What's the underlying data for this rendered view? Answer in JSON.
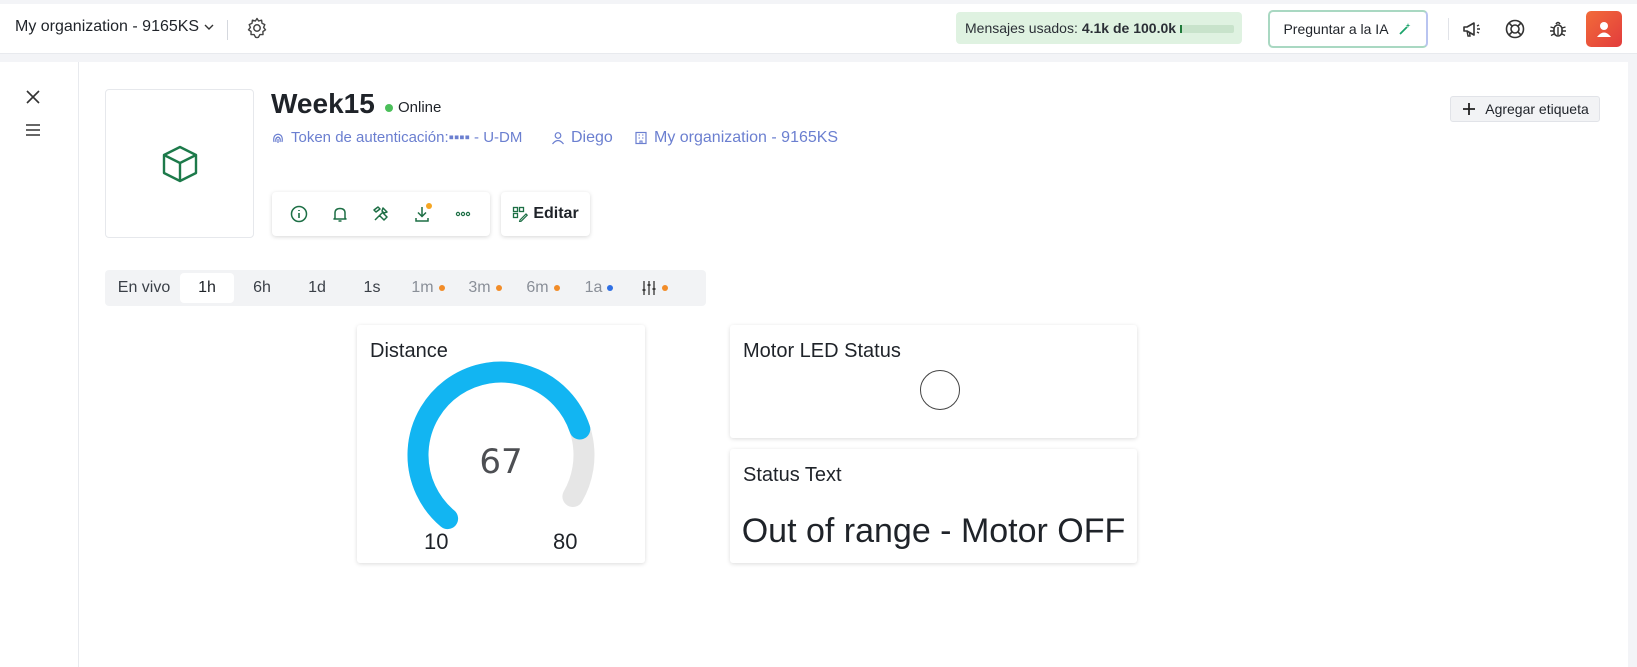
{
  "topbar": {
    "org_name": "My organization - 9165KS",
    "messages_label": "Mensajes usados:",
    "messages_value": "4.1k de 100.0k",
    "messages_progress": 0.041,
    "ask_ai_label": "Preguntar a la IA",
    "icons": [
      "megaphone-icon",
      "help-buoy-icon",
      "bug-icon"
    ]
  },
  "sidebar": {
    "icons": [
      "close-icon",
      "menu-icon"
    ]
  },
  "device": {
    "name": "Week15",
    "status": "Online",
    "status_color": "#4bbf5a",
    "auth_token_label": "Token de autenticación:",
    "auth_token_value": "▪▪▪▪ - U-DM",
    "owner": "Diego",
    "organization": "My organization - 9165KS",
    "add_tag_label": "Agregar etiqueta",
    "edit_label": "Editar",
    "toolbar_icons": [
      "info-icon",
      "bell-icon",
      "tools-icon",
      "download-icon",
      "more-icon"
    ]
  },
  "time_range": {
    "tabs": [
      {
        "label": "En vivo"
      },
      {
        "label": "1h",
        "active": true
      },
      {
        "label": "6h"
      },
      {
        "label": "1d"
      },
      {
        "label": "1s"
      },
      {
        "label": "1m",
        "dot": "#f28c28"
      },
      {
        "label": "3m",
        "dot": "#f28c28"
      },
      {
        "label": "6m",
        "dot": "#f28c28"
      },
      {
        "label": "1a",
        "dot": "#2f6fe4"
      }
    ],
    "settings_dot": "#f28c28"
  },
  "widgets": {
    "distance": {
      "title": "Distance",
      "value": "67",
      "min": "10",
      "max": "80",
      "value_num": 67,
      "min_num": 10,
      "max_num": 80,
      "color": "#12b5f2",
      "track_color": "#e6e6e6"
    },
    "led": {
      "title": "Motor LED Status"
    },
    "status": {
      "title": "Status Text",
      "text": "Out of range - Motor OFF"
    }
  }
}
